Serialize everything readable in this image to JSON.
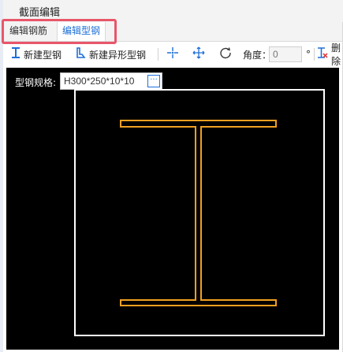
{
  "window": {
    "title": "截面编辑"
  },
  "tabs": [
    {
      "label": "编辑钢筋"
    },
    {
      "label": "编辑型钢"
    }
  ],
  "toolbar": {
    "new_section_steel": "新建型钢",
    "new_irregular_steel": "新建异形型钢",
    "angle_label": "角度：",
    "angle_placeholder": "0",
    "degree_unit": "°",
    "delete_label": "删除"
  },
  "canvas": {
    "spec_label": "型钢规格:",
    "spec_value": "H300*250*10*10",
    "browse_button": "···"
  },
  "colors": {
    "canvas_bg": "#000000",
    "frame": "#ffffff",
    "profile": "#f0a020",
    "accent": "#1e6fd9",
    "highlight": "#e8566a"
  }
}
